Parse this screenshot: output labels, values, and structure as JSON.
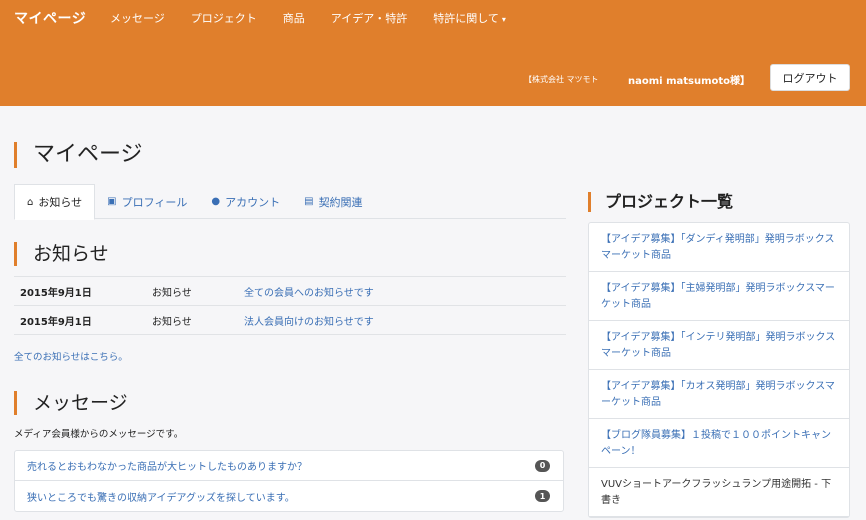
{
  "header": {
    "brand": "マイページ",
    "nav": [
      {
        "label": "メッセージ"
      },
      {
        "label": "プロジェクト"
      },
      {
        "label": "商品"
      },
      {
        "label": "アイデア・特許"
      },
      {
        "label": "特許に関して",
        "caret": "▾"
      }
    ],
    "company": "【株式会社 マツモト",
    "user": "naomi matsumoto様】",
    "logout_label": "ログアウト"
  },
  "page_title": "マイページ",
  "tabs": [
    {
      "icon": "⌂",
      "label": "お知らせ",
      "active": true
    },
    {
      "icon": "▣",
      "label": "プロフィール"
    },
    {
      "icon": "●",
      "label": "アカウント"
    },
    {
      "icon": "▤",
      "label": "契約関連"
    }
  ],
  "news": {
    "heading": "お知らせ",
    "rows": [
      {
        "date": "2015年9月1日",
        "type": "お知らせ",
        "title": "全ての会員へのお知らせです"
      },
      {
        "date": "2015年9月1日",
        "type": "お知らせ",
        "title": "法人会員向けのお知らせです"
      }
    ],
    "all_link": "全てのお知らせはこちら。"
  },
  "messages": {
    "heading": "メッセージ",
    "subtitle": "メディア会員様からのメッセージです。",
    "items": [
      {
        "text": "売れるとおもわなかった商品が大ヒットしたものありますか？",
        "count": "0"
      },
      {
        "text": "狭いところでも驚きの収納アイデアグッズを探しています。",
        "count": "1"
      }
    ]
  },
  "sidebar": {
    "title": "プロジェクト一覧",
    "projects": [
      {
        "text": "【アイデア募集】「ダンディ発明部」発明ラボックスマーケット商品"
      },
      {
        "text": "【アイデア募集】「主婦発明部」発明ラボックスマーケット商品"
      },
      {
        "text": "【アイデア募集】「インテリ発明部」発明ラボックスマーケット商品"
      },
      {
        "text": "【アイデア募集】「カオス発明部」発明ラボックスマーケット商品"
      },
      {
        "text": "【ブログ隊員募集】１投稿で１００ポイントキャンペーン！"
      },
      {
        "text": "VUVショートアークフラッシュランプ用途開拓 - 下書き"
      }
    ]
  }
}
